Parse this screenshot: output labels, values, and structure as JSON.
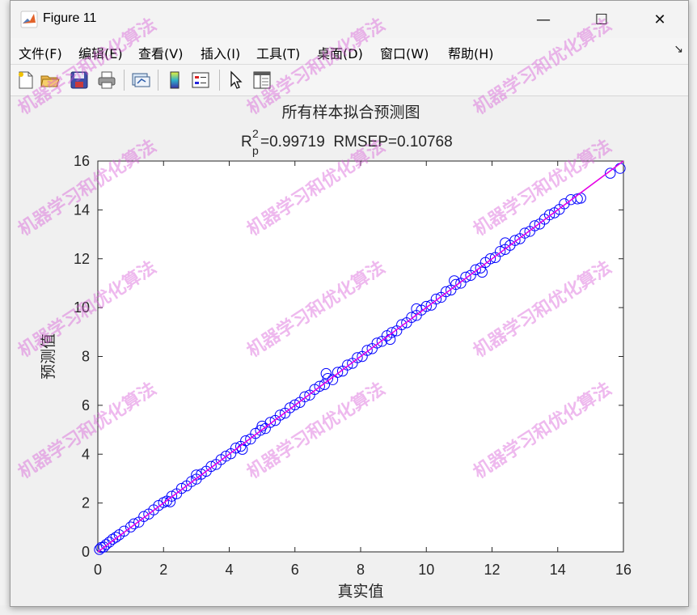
{
  "window": {
    "title": "Figure 11",
    "minimize_symbol": "—",
    "maximize_symbol": "☐",
    "close_symbol": "✕"
  },
  "menu": [
    "文件(F)",
    "编辑(E)",
    "查看(V)",
    "插入(I)",
    "工具(T)",
    "桌面(D)",
    "窗口(W)",
    "帮助(H)"
  ],
  "menu_overflow_symbol": "↘",
  "toolbar": [
    "new-figure-icon",
    "open-file-icon",
    "save-icon",
    "print-icon",
    "link-plot-icon",
    "colorbar-icon",
    "legend-icon",
    "pointer-icon",
    "property-inspector-icon"
  ],
  "watermark": "机器学习和优化算法",
  "chart_data": {
    "type": "scatter",
    "title": "所有样本拟合预测图",
    "subtitle": {
      "r_main": "R",
      "r_sup": "2",
      "r_sub": "p",
      "rest": "=0.99719  RMSEP=0.10768"
    },
    "xlabel": "真实值",
    "ylabel": "预测值",
    "xlim": [
      0,
      16
    ],
    "ylim": [
      0,
      16
    ],
    "xticks": [
      "0",
      "2",
      "4",
      "6",
      "8",
      "10",
      "12",
      "14",
      "16"
    ],
    "yticks": [
      "0",
      "2",
      "4",
      "6",
      "8",
      "10",
      "12",
      "14",
      "16"
    ],
    "series": [
      {
        "marker": "circle",
        "color": "#0000ff",
        "points": [
          [
            0.05,
            0.1
          ],
          [
            0.1,
            0.18
          ],
          [
            0.18,
            0.2
          ],
          [
            0.25,
            0.3
          ],
          [
            0.35,
            0.4
          ],
          [
            0.45,
            0.52
          ],
          [
            0.55,
            0.6
          ],
          [
            0.65,
            0.7
          ],
          [
            0.8,
            0.85
          ],
          [
            1.0,
            1.02
          ],
          [
            1.1,
            1.15
          ],
          [
            1.25,
            1.22
          ],
          [
            1.4,
            1.45
          ],
          [
            1.55,
            1.55
          ],
          [
            1.7,
            1.72
          ],
          [
            1.85,
            1.9
          ],
          [
            2.0,
            2.02
          ],
          [
            2.1,
            2.08
          ],
          [
            2.25,
            2.28
          ],
          [
            2.4,
            2.38
          ],
          [
            2.55,
            2.6
          ],
          [
            2.7,
            2.7
          ],
          [
            2.85,
            2.88
          ],
          [
            3.0,
            2.98
          ],
          [
            3.15,
            3.18
          ],
          [
            3.3,
            3.3
          ],
          [
            3.45,
            3.5
          ],
          [
            3.6,
            3.58
          ],
          [
            3.75,
            3.78
          ],
          [
            3.9,
            3.92
          ],
          [
            4.05,
            4.02
          ],
          [
            4.2,
            4.25
          ],
          [
            4.35,
            4.32
          ],
          [
            4.5,
            4.55
          ],
          [
            4.65,
            4.62
          ],
          [
            4.8,
            4.85
          ],
          [
            4.95,
            4.98
          ],
          [
            5.1,
            5.05
          ],
          [
            5.25,
            5.3
          ],
          [
            5.4,
            5.38
          ],
          [
            5.55,
            5.6
          ],
          [
            5.7,
            5.68
          ],
          [
            5.85,
            5.9
          ],
          [
            6.0,
            6.02
          ],
          [
            6.15,
            6.12
          ],
          [
            6.3,
            6.35
          ],
          [
            6.45,
            6.42
          ],
          [
            6.6,
            6.65
          ],
          [
            6.75,
            6.78
          ],
          [
            6.9,
            6.85
          ],
          [
            7.0,
            7.1
          ],
          [
            7.15,
            7.05
          ],
          [
            7.3,
            7.35
          ],
          [
            7.45,
            7.4
          ],
          [
            7.6,
            7.65
          ],
          [
            7.75,
            7.72
          ],
          [
            7.9,
            7.95
          ],
          [
            8.05,
            8.0
          ],
          [
            8.2,
            8.25
          ],
          [
            8.35,
            8.32
          ],
          [
            8.5,
            8.55
          ],
          [
            8.65,
            8.62
          ],
          [
            8.8,
            8.85
          ],
          [
            8.95,
            8.98
          ],
          [
            9.1,
            9.05
          ],
          [
            9.25,
            9.3
          ],
          [
            9.4,
            9.38
          ],
          [
            9.55,
            9.6
          ],
          [
            9.7,
            9.68
          ],
          [
            9.85,
            9.9
          ],
          [
            10.0,
            10.05
          ],
          [
            10.15,
            10.1
          ],
          [
            10.3,
            10.35
          ],
          [
            10.45,
            10.42
          ],
          [
            10.6,
            10.65
          ],
          [
            10.75,
            10.72
          ],
          [
            10.9,
            10.95
          ],
          [
            11.05,
            11.0
          ],
          [
            11.2,
            11.25
          ],
          [
            11.35,
            11.32
          ],
          [
            11.5,
            11.55
          ],
          [
            11.65,
            11.62
          ],
          [
            11.8,
            11.85
          ],
          [
            11.95,
            12.0
          ],
          [
            12.1,
            12.05
          ],
          [
            12.25,
            12.3
          ],
          [
            12.4,
            12.38
          ],
          [
            12.55,
            12.55
          ],
          [
            12.7,
            12.75
          ],
          [
            12.85,
            12.82
          ],
          [
            13.0,
            13.05
          ],
          [
            13.15,
            13.12
          ],
          [
            13.3,
            13.35
          ],
          [
            13.45,
            13.42
          ],
          [
            13.6,
            13.62
          ],
          [
            13.75,
            13.8
          ],
          [
            13.9,
            13.88
          ],
          [
            14.05,
            14.02
          ],
          [
            14.2,
            14.25
          ],
          [
            14.4,
            14.42
          ],
          [
            14.6,
            14.45
          ],
          [
            14.7,
            14.48
          ],
          [
            15.6,
            15.5
          ],
          [
            15.9,
            15.7
          ],
          [
            3.0,
            3.15
          ],
          [
            5.0,
            5.15
          ],
          [
            6.95,
            7.3
          ],
          [
            8.9,
            8.7
          ],
          [
            10.85,
            11.1
          ],
          [
            11.7,
            11.45
          ],
          [
            12.4,
            12.65
          ],
          [
            9.7,
            9.95
          ],
          [
            4.4,
            4.2
          ],
          [
            2.2,
            2.05
          ]
        ]
      }
    ],
    "fit_line": {
      "color": "#e600e6",
      "from": [
        0,
        0
      ],
      "to": [
        16,
        16
      ]
    },
    "grid": false
  }
}
